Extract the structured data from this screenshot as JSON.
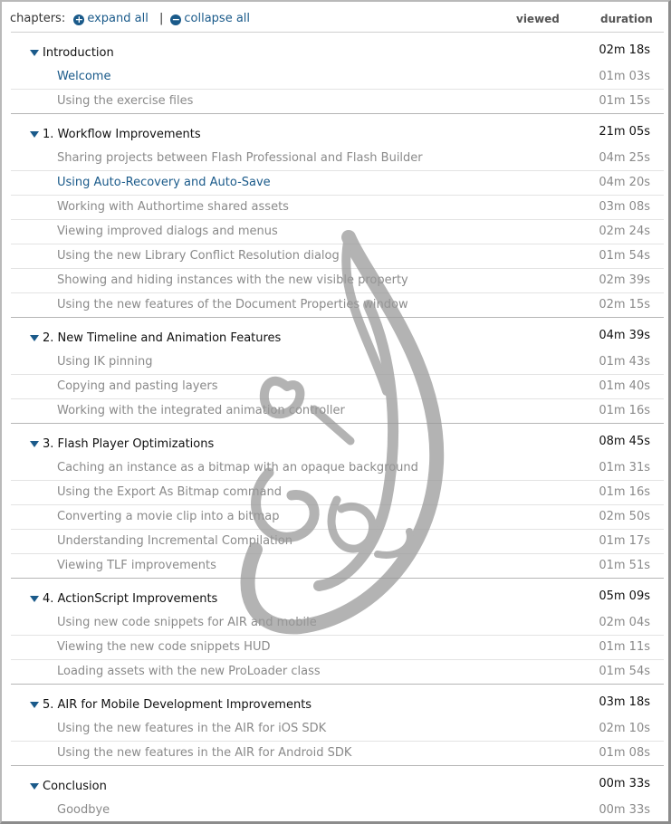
{
  "header": {
    "chapters_label": "chapters:",
    "expand_label": "expand all",
    "separator": "|",
    "collapse_label": "collapse all",
    "viewed_label": "viewed",
    "duration_label": "duration"
  },
  "icons": {
    "expand": "plus-circle-icon",
    "collapse": "minus-circle-icon",
    "chapter_toggle": "triangle-down-icon"
  },
  "colors": {
    "link": "#1a5a8a",
    "muted": "#8a8a8a",
    "watermark": "#9a9a9a"
  },
  "chapters": [
    {
      "title": "Introduction",
      "duration": "02m 18s",
      "items": [
        {
          "title": "Welcome",
          "duration": "01m 03s",
          "active": true
        },
        {
          "title": "Using the exercise files",
          "duration": "01m 15s",
          "active": false
        }
      ]
    },
    {
      "title": "1. Workflow Improvements",
      "duration": "21m 05s",
      "items": [
        {
          "title": "Sharing projects between Flash Professional and Flash Builder",
          "duration": "04m 25s",
          "active": false
        },
        {
          "title": "Using Auto-Recovery and Auto-Save",
          "duration": "04m 20s",
          "active": true
        },
        {
          "title": "Working with Authortime shared assets",
          "duration": "03m 08s",
          "active": false
        },
        {
          "title": "Viewing improved dialogs and menus",
          "duration": "02m 24s",
          "active": false
        },
        {
          "title": "Using the new Library Conflict Resolution dialog",
          "duration": "01m 54s",
          "active": false
        },
        {
          "title": "Showing and hiding instances with the new visible property",
          "duration": "02m 39s",
          "active": false
        },
        {
          "title": "Using the new features of the Document Properties window",
          "duration": "02m 15s",
          "active": false
        }
      ]
    },
    {
      "title": "2. New Timeline and Animation Features",
      "duration": "04m 39s",
      "items": [
        {
          "title": "Using IK pinning",
          "duration": "01m 43s",
          "active": false
        },
        {
          "title": "Copying and pasting layers",
          "duration": "01m 40s",
          "active": false
        },
        {
          "title": "Working with the integrated animation controller",
          "duration": "01m 16s",
          "active": false
        }
      ]
    },
    {
      "title": "3. Flash Player Optimizations",
      "duration": "08m 45s",
      "items": [
        {
          "title": "Caching an instance as a bitmap with an opaque background",
          "duration": "01m 31s",
          "active": false
        },
        {
          "title": "Using the Export As Bitmap command",
          "duration": "01m 16s",
          "active": false
        },
        {
          "title": "Converting a movie clip into a bitmap",
          "duration": "02m 50s",
          "active": false
        },
        {
          "title": "Understanding Incremental Compilation",
          "duration": "01m 17s",
          "active": false
        },
        {
          "title": "Viewing TLF improvements",
          "duration": "01m 51s",
          "active": false
        }
      ]
    },
    {
      "title": "4. ActionScript Improvements",
      "duration": "05m 09s",
      "items": [
        {
          "title": "Using new code snippets for AIR and mobile",
          "duration": "02m 04s",
          "active": false
        },
        {
          "title": "Viewing the new code snippets HUD",
          "duration": "01m 11s",
          "active": false
        },
        {
          "title": "Loading assets with the new ProLoader class",
          "duration": "01m 54s",
          "active": false
        }
      ]
    },
    {
      "title": "5. AIR for Mobile Development Improvements",
      "duration": "03m 18s",
      "items": [
        {
          "title": "Using the new features in the AIR for iOS SDK",
          "duration": "02m 10s",
          "active": false
        },
        {
          "title": "Using the new features in the AIR for Android SDK",
          "duration": "01m 08s",
          "active": false
        }
      ]
    },
    {
      "title": "Conclusion",
      "duration": "00m 33s",
      "items": [
        {
          "title": "Goodbye",
          "duration": "00m 33s",
          "active": false
        }
      ]
    }
  ]
}
